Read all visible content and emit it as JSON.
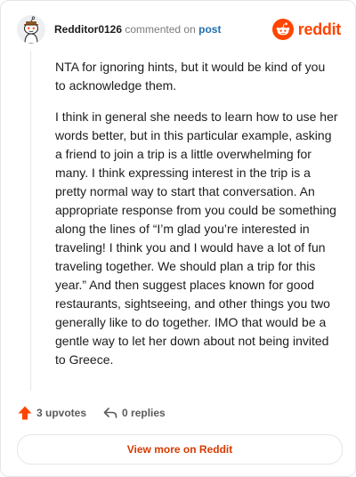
{
  "header": {
    "username": "Redditor0126",
    "action_text": "commented on",
    "post_link_label": "post",
    "brand_name": "reddit",
    "avatar_icon": "snoo-avatar-icon",
    "brand_icon": "reddit-snoo-icon"
  },
  "comment": {
    "paragraphs": [
      "NTA for ignoring hints, but it would be kind of you to acknowledge them.",
      "I think in general she needs to learn how to use her words better, but in this particular example, asking a friend to join a trip is a little overwhelming for many. I think expressing interest in the trip is a pretty normal way to start that conversation. An appropriate response from you could be something along the lines of “I’m glad you’re interested in traveling! I think you and I would have a lot of fun traveling together. We should plan a trip for this year.” And then suggest places known for good restaurants, sightseeing, and other things you two generally like to do together. IMO that would be a gentle way to let her down about not being invited to Greece."
    ]
  },
  "actions": {
    "upvotes_label": "3 upvotes",
    "replies_label": "0 replies",
    "upvote_icon": "upvote-arrow-icon",
    "reply_icon": "reply-arrow-icon"
  },
  "footer": {
    "view_more_label": "View more on Reddit"
  },
  "colors": {
    "brand": "#ff4500",
    "link": "#1f6fb0",
    "view_more_text": "#d93a00",
    "upvote": "#ff4500"
  }
}
